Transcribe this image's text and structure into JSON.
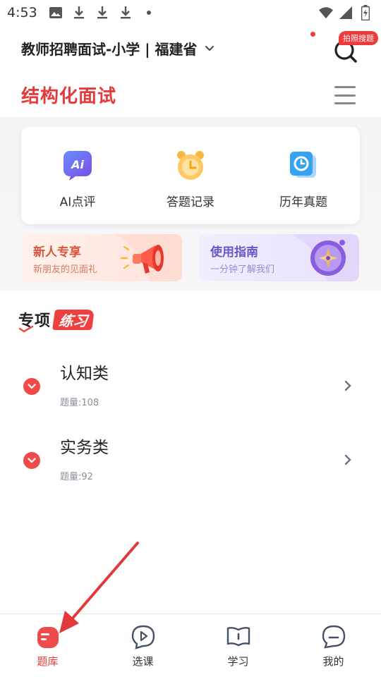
{
  "status_bar": {
    "time": "4:53",
    "icons_left": [
      "image-icon",
      "download-icon",
      "download-icon",
      "download-icon",
      "dot-icon"
    ],
    "icons_right": [
      "wifi-icon",
      "signal-icon",
      "battery-icon"
    ]
  },
  "header": {
    "exam_title": "教师招聘面试-小学 | 福建省",
    "search_badge": "拍照搜题"
  },
  "page": {
    "section_title": "结构化面试"
  },
  "quick_actions": [
    {
      "label": "AI点评",
      "icon": "ai-review-icon"
    },
    {
      "label": "答题记录",
      "icon": "clock-record-icon"
    },
    {
      "label": "历年真题",
      "icon": "past-papers-icon"
    }
  ],
  "promos": [
    {
      "title": "新人专享",
      "subtitle": "新朋友的见面礼",
      "icon": "megaphone-icon"
    },
    {
      "title": "使用指南",
      "subtitle": "一分钟了解我们",
      "icon": "compass-icon"
    }
  ],
  "special_practice": {
    "title_a": "专项",
    "title_b": "练习",
    "categories": [
      {
        "name": "认知类",
        "count": "题量:108"
      },
      {
        "name": "实务类",
        "count": "题量:92"
      }
    ]
  },
  "bottom_nav": [
    {
      "label": "题库",
      "active": true
    },
    {
      "label": "选课",
      "active": false
    },
    {
      "label": "学习",
      "active": false
    },
    {
      "label": "我的",
      "active": false
    }
  ],
  "colors": {
    "accent": "#ee3a3a",
    "text": "#222222",
    "muted": "#8a8f99"
  }
}
